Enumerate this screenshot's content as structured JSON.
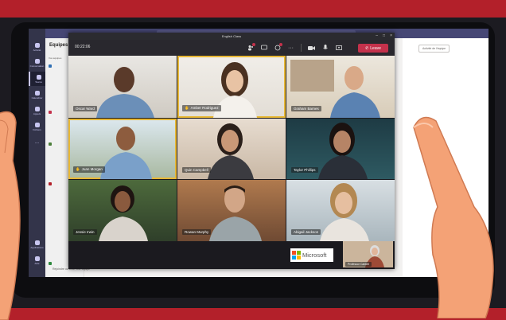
{
  "meeting": {
    "window_title": "English Class",
    "timer": "00:22:06",
    "leave_label": "Leave",
    "participants": [
      {
        "name": "Oscar Ward"
      },
      {
        "name": "Amber Rodriguez",
        "hand_raised": true
      },
      {
        "name": "Graham Barnes"
      },
      {
        "name": "Juan Morgan",
        "hand_raised": true
      },
      {
        "name": "Quin Campbell"
      },
      {
        "name": "Taylor Phillips"
      },
      {
        "name": "Jessie Irwin"
      },
      {
        "name": "Rowan Murphy"
      },
      {
        "name": "Abigail Jackson"
      }
    ],
    "self_view": {
      "name": "Professor Cantell"
    },
    "logo_text": "Microsoft",
    "accent_speaking": "#e8b836",
    "leave_color": "#c4314b"
  },
  "teams": {
    "panel_title": "Equipes",
    "panel_subtitle": "Vos équipes",
    "rail_items": [
      "Activité",
      "Conversation",
      "Teams",
      "Calendrier",
      "Appels",
      "Fichiers",
      "...",
      "Applications",
      "Aide"
    ],
    "main_button": "Activité de l'équipe",
    "new_chat": "Rejoindre ou créer une équipe"
  },
  "icons": [
    "participants-icon",
    "chat-icon",
    "reactions-icon",
    "more-icon",
    "camera-icon",
    "mic-icon",
    "share-icon",
    "phone-icon"
  ]
}
